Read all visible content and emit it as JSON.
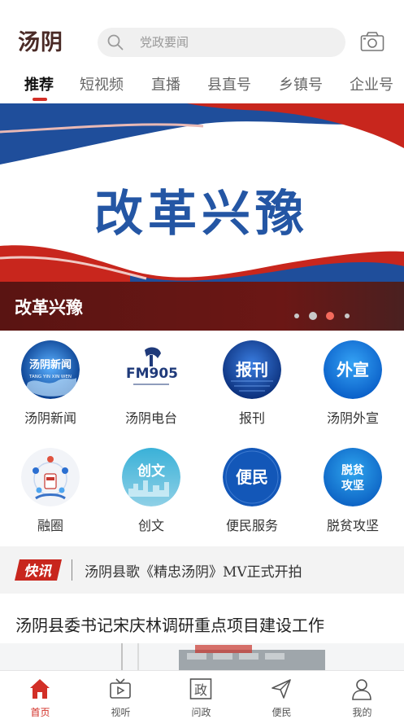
{
  "app": {
    "logo_text": "汤阴"
  },
  "search": {
    "placeholder": "党政要闻"
  },
  "tabs": [
    {
      "label": "推荐",
      "active": true
    },
    {
      "label": "短视频"
    },
    {
      "label": "直播"
    },
    {
      "label": "县直号"
    },
    {
      "label": "乡镇号"
    },
    {
      "label": "企业号"
    }
  ],
  "banner": {
    "headline": "改革兴豫",
    "caption": "改革兴豫",
    "slide_count": 4,
    "active_slide": 3
  },
  "services": [
    {
      "label": "汤阴新闻",
      "icon": "tangyin-news-icon",
      "icon_text": "汤阴新闻",
      "icon_subtext": "TANG YIN XIN WEN"
    },
    {
      "label": "汤阴电台",
      "icon": "fm905-radio-icon",
      "icon_text": "FM905"
    },
    {
      "label": "报刊",
      "icon": "newspaper-icon",
      "icon_text": "报刊"
    },
    {
      "label": "汤阴外宣",
      "icon": "publicity-icon",
      "icon_text": "外宣"
    },
    {
      "label": "融圈",
      "icon": "circle-community-icon"
    },
    {
      "label": "创文",
      "icon": "civilization-icon",
      "icon_text": "创文"
    },
    {
      "label": "便民服务",
      "icon": "convenience-icon",
      "icon_text": "便民"
    },
    {
      "label": "脱贫攻坚",
      "icon": "poverty-alleviation-icon",
      "icon_text": "脱贫攻坚"
    }
  ],
  "news_flash": {
    "badge": "快讯",
    "text": "汤阴县歌《精忠汤阴》MV正式开拍"
  },
  "article": {
    "title": "汤阴县委书记宋庆林调研重点项目建设工作"
  },
  "bottom_nav": [
    {
      "label": "首页",
      "icon": "home-icon",
      "active": true
    },
    {
      "label": "视听",
      "icon": "tv-icon"
    },
    {
      "label": "问政",
      "icon": "politics-icon",
      "icon_text": "政"
    },
    {
      "label": "便民",
      "icon": "send-icon"
    },
    {
      "label": "我的",
      "icon": "user-icon"
    }
  ],
  "colors": {
    "accent": "#d22f27",
    "banner_blue": "#1f4e9b",
    "banner_red": "#c8261d",
    "caption_bg": "#5a1412"
  }
}
